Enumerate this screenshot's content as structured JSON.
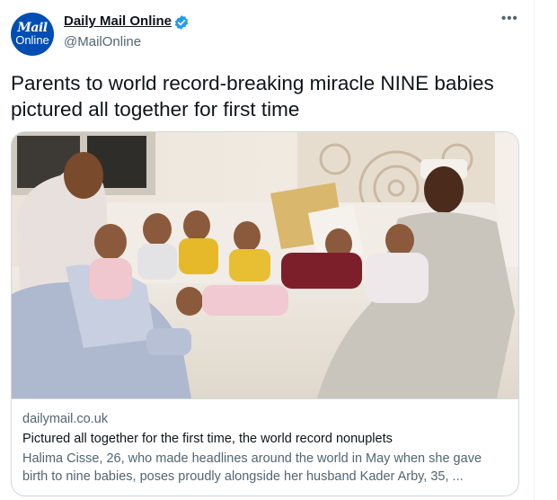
{
  "account": {
    "avatar_line1": "Mail",
    "avatar_line2": "Online",
    "display_name": "Daily Mail Online",
    "handle": "@MailOnline",
    "verified": true
  },
  "menu": {
    "more_label": "•••"
  },
  "tweet": {
    "text": "Parents to world record-breaking miracle NINE babies pictured all together for first time"
  },
  "link_card": {
    "domain": "dailymail.co.uk",
    "title": "Pictured all together for the first time, the world record nonuplets",
    "description": "Halima Cisse, 26, who made headlines around the world in May when she gave birth to nine babies, poses proudly alongside her husband Kader Arby, 35, ..."
  },
  "colors": {
    "avatar_bg": "#004db3",
    "verified_blue": "#1d9bf0",
    "secondary_text": "#536471",
    "border": "#cfd9de"
  }
}
